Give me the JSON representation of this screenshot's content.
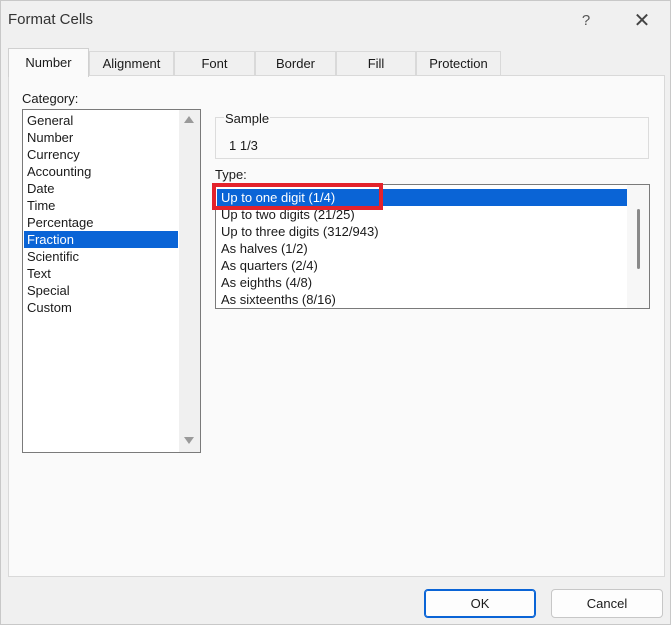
{
  "window": {
    "title": "Format Cells",
    "help_label": "?",
    "close_label": "✕"
  },
  "tabs": [
    {
      "label": "Number"
    },
    {
      "label": "Alignment"
    },
    {
      "label": "Font"
    },
    {
      "label": "Border"
    },
    {
      "label": "Fill"
    },
    {
      "label": "Protection"
    }
  ],
  "category": {
    "label": "Category:",
    "items": [
      "General",
      "Number",
      "Currency",
      "Accounting",
      "Date",
      "Time",
      "Percentage",
      "Fraction",
      "Scientific",
      "Text",
      "Special",
      "Custom"
    ],
    "selected": "Fraction"
  },
  "sample": {
    "label": "Sample",
    "value": "1 1/3"
  },
  "type": {
    "label": "Type:",
    "items": [
      "Up to one digit (1/4)",
      "Up to two digits (21/25)",
      "Up to three digits (312/943)",
      "As halves (1/2)",
      "As quarters (2/4)",
      "As eighths (4/8)",
      "As sixteenths (8/16)"
    ],
    "selected": "Up to one digit (1/4)"
  },
  "buttons": {
    "ok": "OK",
    "cancel": "Cancel"
  },
  "colors": {
    "selection": "#0a64d6",
    "annotation": "#e3222b"
  }
}
